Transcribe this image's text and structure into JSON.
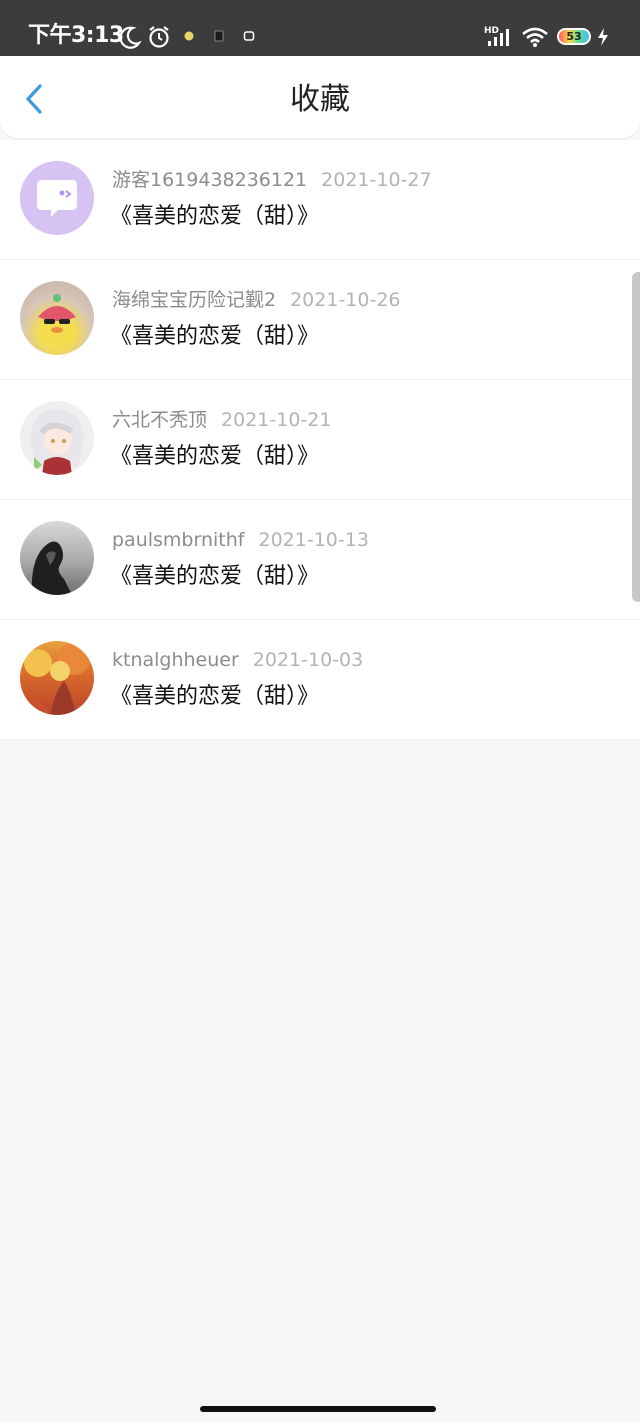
{
  "status_bar": {
    "time": "下午3:13",
    "network_label": "HD",
    "battery_level": "53"
  },
  "header": {
    "title": "收藏",
    "back_icon": "chevron-left-icon",
    "accent_color": "#3b9bdc"
  },
  "favorites": [
    {
      "username": "游客1619438236121",
      "date": "2021-10-27",
      "work": "《喜美的恋爱（甜）》",
      "avatar": "purple-speech-bubble-avatar"
    },
    {
      "username": "海绵宝宝历险记觐2",
      "date": "2021-10-26",
      "work": "《喜美的恋爱（甜）》",
      "avatar": "toy-duck-avatar"
    },
    {
      "username": "六北不秃顶",
      "date": "2021-10-21",
      "work": "《喜美的恋爱（甜）》",
      "avatar": "anime-girl-avatar"
    },
    {
      "username": "paulsmbrnithf",
      "date": "2021-10-13",
      "work": "《喜美的恋爱（甜）》",
      "avatar": "grayscale-portrait-avatar"
    },
    {
      "username": "ktnalghheuer",
      "date": "2021-10-03",
      "work": "《喜美的恋爱（甜）》",
      "avatar": "autumn-road-avatar"
    }
  ]
}
